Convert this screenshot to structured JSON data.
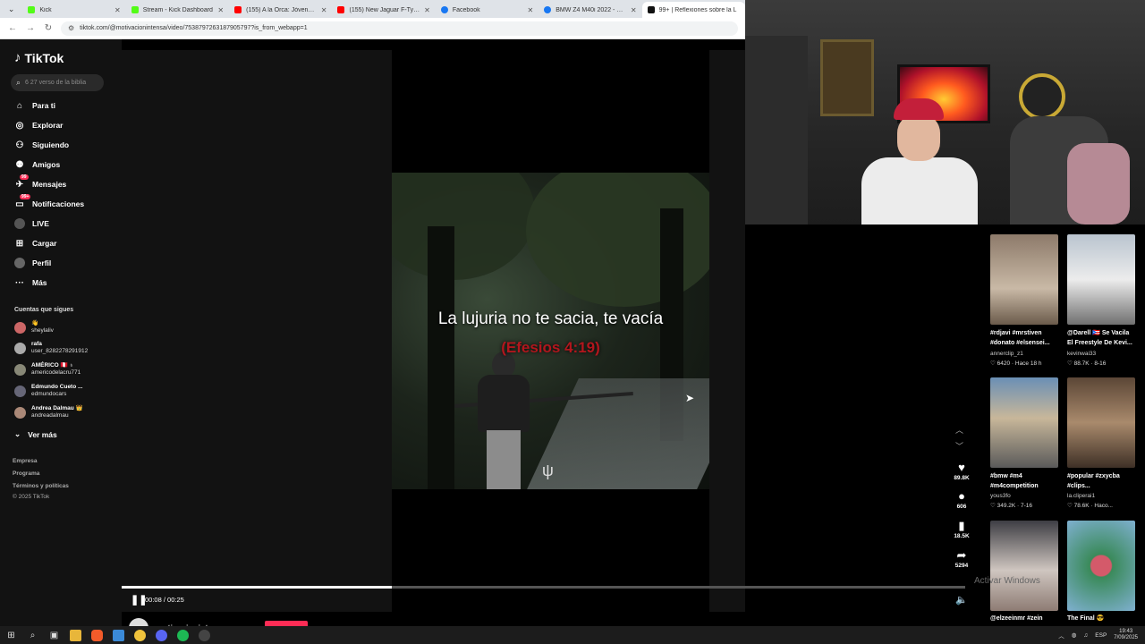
{
  "browser": {
    "tabs": [
      {
        "title": "Kick",
        "color": "#53fc18"
      },
      {
        "title": "Stream - Kick Dashboard",
        "color": "#53fc18"
      },
      {
        "title": "(155) A la Orca: Jóvenes causa",
        "color": "#ff0000"
      },
      {
        "title": "(155) New Jaguar F-Type R (F)",
        "color": "#ff0000"
      },
      {
        "title": "Facebook",
        "color": "#1877f2"
      },
      {
        "title": "BMW Z4 M40i 2022 - Cars & Tr",
        "color": "#1877f2"
      },
      {
        "title": "99+ | Reflexiones sobre la L",
        "color": "#111111"
      }
    ],
    "url": "tiktok.com/@motivacionintensa/video/7538797263187905797?is_from_webapp=1"
  },
  "sidebar": {
    "logo": "TikTok",
    "search_placeholder": "6 27 verso de la biblia",
    "nav": [
      {
        "label": "Para ti",
        "icon": "home-icon"
      },
      {
        "label": "Explorar",
        "icon": "compass-icon"
      },
      {
        "label": "Siguiendo",
        "icon": "following-icon"
      },
      {
        "label": "Amigos",
        "icon": "friends-icon"
      },
      {
        "label": "Mensajes",
        "icon": "messages-icon",
        "badge": "99"
      },
      {
        "label": "Notificaciones",
        "icon": "notifications-icon",
        "badge": "99+"
      },
      {
        "label": "LIVE",
        "icon": "live-icon"
      },
      {
        "label": "Cargar",
        "icon": "upload-icon"
      },
      {
        "label": "Perfil",
        "icon": "profile-icon"
      },
      {
        "label": "Más",
        "icon": "more-icon"
      }
    ],
    "following_title": "Cuentas que sigues",
    "accounts": [
      {
        "name": "👋",
        "user": "sheylaliv"
      },
      {
        "name": "rafa",
        "user": "user_8282278291912"
      },
      {
        "name": "AMÉRICO 🇵🇪 ♁",
        "user": "americodelacru771"
      },
      {
        "name": "Edmundo Cueto ...",
        "user": "edmundocars"
      },
      {
        "name": "Andrea Dalmau 👑",
        "user": "andreadalmau"
      }
    ],
    "see_more": "Ver más",
    "footer": [
      "Empresa",
      "Programa",
      "Términos y políticas",
      "© 2025 TikTok"
    ]
  },
  "video": {
    "caption_main": "La lujuria no te sacia, te vacía",
    "caption_ref": "(Efesios 4:19)",
    "time": "00:08 / 00:25",
    "progress": 0.32,
    "creator": "motivacionintensa"
  },
  "actions": [
    {
      "icon": "heart-icon",
      "count": "89.8K"
    },
    {
      "icon": "comment-icon",
      "count": "606"
    },
    {
      "icon": "bookmark-icon",
      "count": "18.5K"
    },
    {
      "icon": "share-icon",
      "count": "5294"
    }
  ],
  "related": [
    {
      "caption1": "#rdjavi #mrstiven",
      "caption2": "#donato #elsensei...",
      "author": "annerclip_z1",
      "stats": "♡ 6420 · Hace 18 h"
    },
    {
      "caption1": "@Darell 🇵🇷 Se Vacila",
      "caption2": "El Freestyle De Kevi...",
      "author": "kevinwai33",
      "stats": "♡ 88.7K · 8-16"
    },
    {
      "caption1": "#bmw #m4",
      "caption2": "#m4competition",
      "author": "yous3fo",
      "stats": "♡ 349.2K · 7-16"
    },
    {
      "caption1": "#popular #zxycba",
      "caption2": "#clips...",
      "author": "la.cliperai1",
      "stats": "♡ 78.6K · Haco..."
    },
    {
      "caption1": "@elzeeinmr #zein",
      "caption2": "",
      "author": "",
      "stats": ""
    },
    {
      "caption1": "The Final 😎",
      "caption2": "",
      "author": "",
      "stats": ""
    }
  ],
  "watermark": "Activar Windows",
  "taskbar": {
    "lang": "ESP",
    "time": "19:43",
    "date": "7/09/2025"
  }
}
